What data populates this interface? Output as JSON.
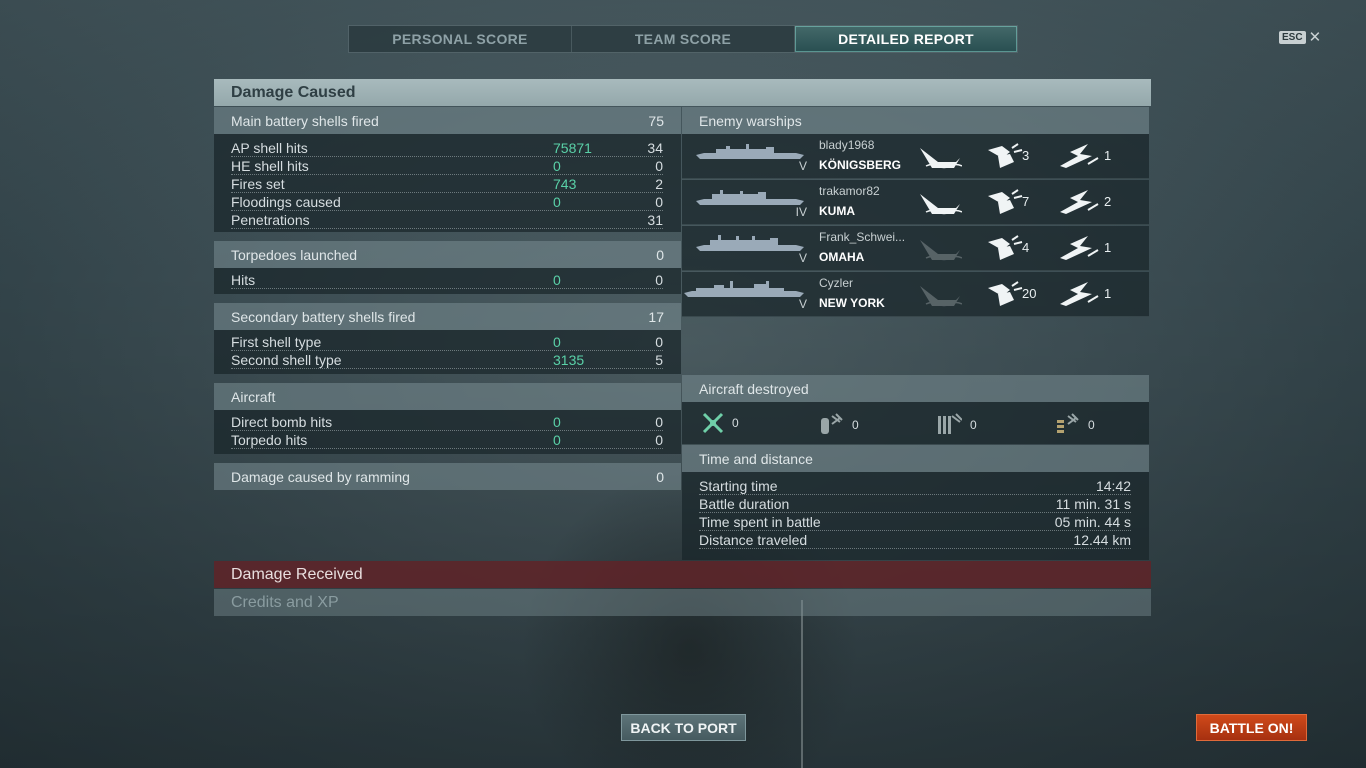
{
  "tabs": [
    {
      "label": "PERSONAL SCORE"
    },
    {
      "label": "TEAM SCORE"
    },
    {
      "label": "DETAILED REPORT"
    }
  ],
  "esc": {
    "key": "ESC",
    "close": "✕"
  },
  "damage_caused": {
    "title": "Damage Caused",
    "main_battery": {
      "label": "Main battery shells fired",
      "value": "75",
      "rows": [
        {
          "label": "AP shell hits",
          "damage": "75871",
          "count": "34"
        },
        {
          "label": "HE shell hits",
          "damage": "0",
          "count": "0"
        },
        {
          "label": "Fires set",
          "damage": "743",
          "count": "2"
        },
        {
          "label": "Floodings caused",
          "damage": "0",
          "count": "0"
        },
        {
          "label": "Penetrations",
          "damage": "",
          "count": "31"
        }
      ]
    },
    "torpedoes": {
      "label": "Torpedoes launched",
      "value": "0",
      "rows": [
        {
          "label": "Hits",
          "damage": "0",
          "count": "0"
        }
      ]
    },
    "secondary": {
      "label": "Secondary battery shells fired",
      "value": "17",
      "rows": [
        {
          "label": "First shell type",
          "damage": "0",
          "count": "0"
        },
        {
          "label": "Second shell type",
          "damage": "3135",
          "count": "5"
        }
      ]
    },
    "aircraft": {
      "label": "Aircraft",
      "rows": [
        {
          "label": "Direct bomb hits",
          "damage": "0",
          "count": "0"
        },
        {
          "label": "Torpedo hits",
          "damage": "0",
          "count": "0"
        }
      ]
    },
    "ramming": {
      "label": "Damage caused by ramming",
      "value": "0"
    }
  },
  "enemy_warships": {
    "label": "Enemy warships",
    "ships": [
      {
        "player": "blady1968",
        "ship": "KÖNIGSBERG",
        "tier": "V",
        "hits": "3",
        "crits": "1",
        "destroyed": true
      },
      {
        "player": "trakamor82",
        "ship": "KUMA",
        "tier": "IV",
        "hits": "7",
        "crits": "2",
        "destroyed": true
      },
      {
        "player": "Frank_Schwei...",
        "ship": "OMAHA",
        "tier": "V",
        "hits": "4",
        "crits": "1",
        "destroyed": false
      },
      {
        "player": "Cyzler",
        "ship": "NEW YORK",
        "tier": "V",
        "hits": "20",
        "crits": "1",
        "destroyed": false
      }
    ]
  },
  "aircraft_destroyed": {
    "label": "Aircraft destroyed",
    "items": [
      {
        "icon": "fighter-plane-icon",
        "value": "0"
      },
      {
        "icon": "bomb-icon",
        "value": "0"
      },
      {
        "icon": "torpedo-bomber-icon",
        "value": "0"
      },
      {
        "icon": "ammo-icon",
        "value": "0"
      }
    ]
  },
  "time_distance": {
    "label": "Time and distance",
    "rows": [
      {
        "label": "Starting time",
        "value": "14:42"
      },
      {
        "label": "Battle duration",
        "value": "11 min. 31 s"
      },
      {
        "label": "Time spent in battle",
        "value": "05 min. 44 s"
      },
      {
        "label": "Distance traveled",
        "value": "12.44 km"
      }
    ]
  },
  "damage_received": {
    "label": "Damage Received"
  },
  "credits_xp": {
    "label": "Credits and XP"
  },
  "buttons": {
    "back": "BACK TO PORT",
    "battle": "BATTLE ON!"
  },
  "colors": {
    "accent_green": "#5ad1a8",
    "battle_orange": "#c8401a",
    "received_red": "#5f2328"
  }
}
